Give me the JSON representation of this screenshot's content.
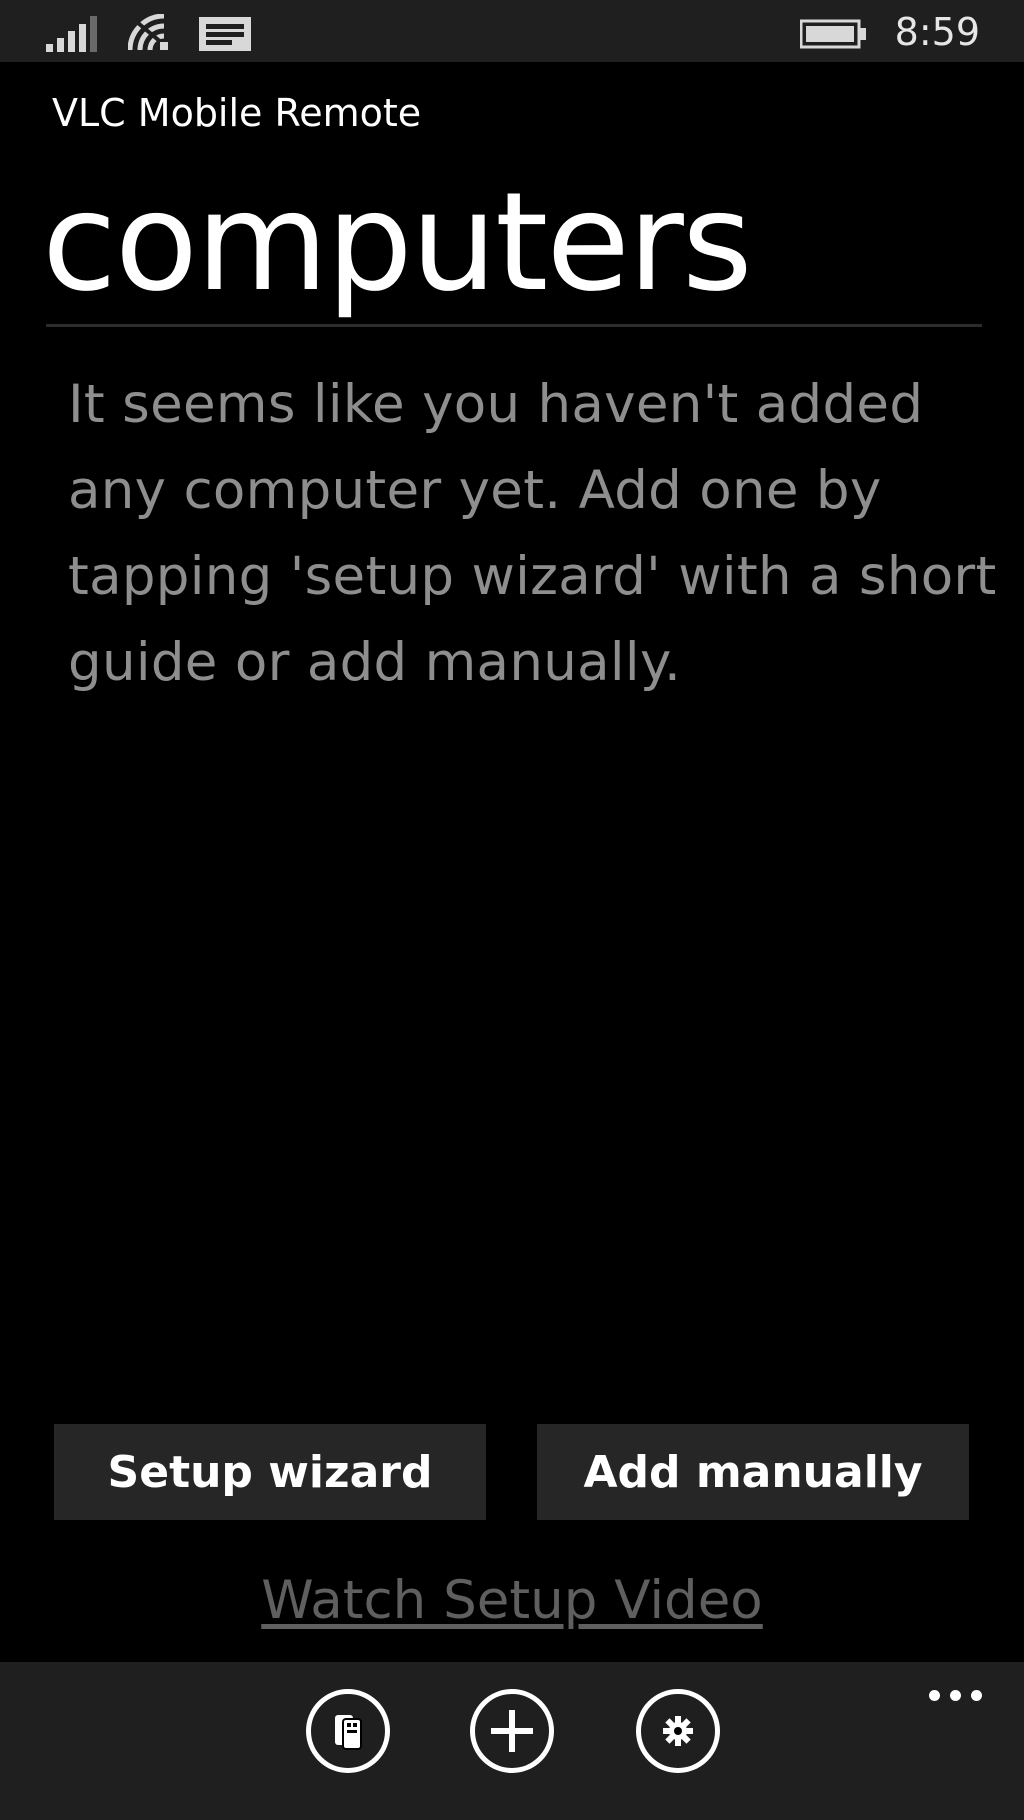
{
  "status_bar": {
    "time": "8:59",
    "icons": [
      "signal-bars-icon",
      "wifi-icon",
      "message-icon",
      "battery-icon"
    ]
  },
  "header": {
    "app_title": "VLC Mobile Remote",
    "page_title": "computers"
  },
  "main": {
    "empty_message": "It seems like you haven't added any computer yet. Add one by tapping 'setup wizard' with a short guide or add manually.",
    "buttons": {
      "setup_wizard": "Setup wizard",
      "add_manually": "Add manually"
    },
    "watch_video_link": "Watch Setup Video"
  },
  "app_bar": {
    "icons": [
      "remote-icon",
      "add-icon",
      "settings-icon",
      "more-icon"
    ]
  },
  "colors": {
    "background": "#000000",
    "chrome": "#1f1f1f",
    "button": "#262626",
    "message_text": "#8e8e8e",
    "link_text": "#5f5f5f"
  }
}
